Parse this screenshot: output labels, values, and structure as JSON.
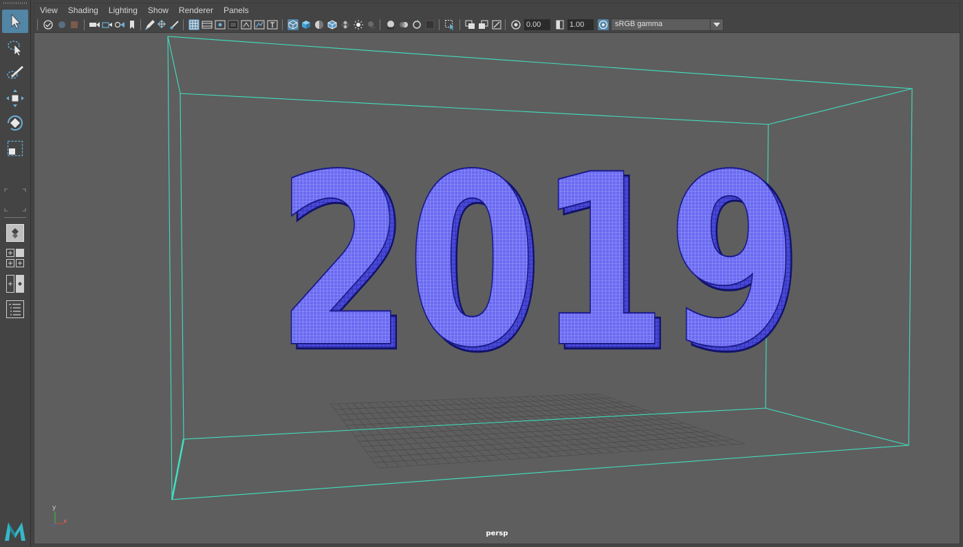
{
  "menubar": {
    "items": [
      "View",
      "Shading",
      "Lighting",
      "Show",
      "Renderer",
      "Panels"
    ]
  },
  "iconbar": {
    "exposure_value": "0.00",
    "gamma_value": "1.00",
    "color_space": "sRGB gamma"
  },
  "viewport": {
    "camera_label": "persp",
    "axis_y": "y",
    "axis_x": "x",
    "text_geometry": "2019"
  },
  "colors": {
    "accent": "#5285a6",
    "bounding_box": "#40e0c0",
    "text_mesh": "#5a5af0",
    "grid": "#4a4a4a"
  },
  "icons": {
    "toolbox": [
      "select-arrow-icon",
      "lasso-select-icon",
      "paint-select-icon",
      "move-tool-icon",
      "rotate-tool-icon",
      "scale-tool-icon",
      "single-view-layout-icon",
      "four-view-layout-icon",
      "two-view-layout-icon",
      "outliner-layout-icon",
      "maya-logo-icon"
    ]
  }
}
